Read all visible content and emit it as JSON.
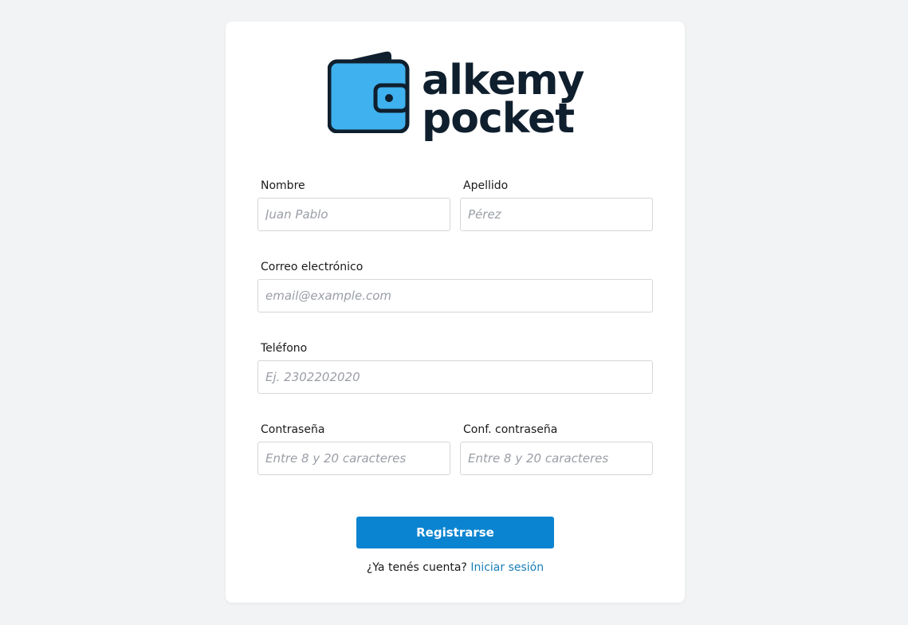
{
  "brand": {
    "line1": "alkemy",
    "line2": "pocket",
    "text_color": "#0f1f2e",
    "wallet_color": "#3fb1ef",
    "wallet_outline": "#0f1f2e"
  },
  "form": {
    "nombre": {
      "label": "Nombre",
      "placeholder": "Juan Pablo",
      "value": ""
    },
    "apellido": {
      "label": "Apellido",
      "placeholder": "Pérez",
      "value": ""
    },
    "correo": {
      "label": "Correo electrónico",
      "placeholder": "email@example.com",
      "value": ""
    },
    "telefono": {
      "label": "Teléfono",
      "placeholder": "Ej. 2302202020",
      "value": ""
    },
    "contrasena": {
      "label": "Contraseña",
      "placeholder": "Entre 8 y 20 caracteres",
      "value": ""
    },
    "conf_contrasena": {
      "label": "Conf. contraseña",
      "placeholder": "Entre 8 y 20 caracteres",
      "value": ""
    },
    "submit_label": "Registrarse"
  },
  "footer": {
    "question": "¿Ya tenés cuenta?",
    "link_label": "Iniciar sesión"
  },
  "colors": {
    "page_bg": "#f2f3f5",
    "card_bg": "#ffffff",
    "primary": "#0a84d0",
    "link": "#1a7fb8",
    "input_border": "#d4d6da"
  }
}
